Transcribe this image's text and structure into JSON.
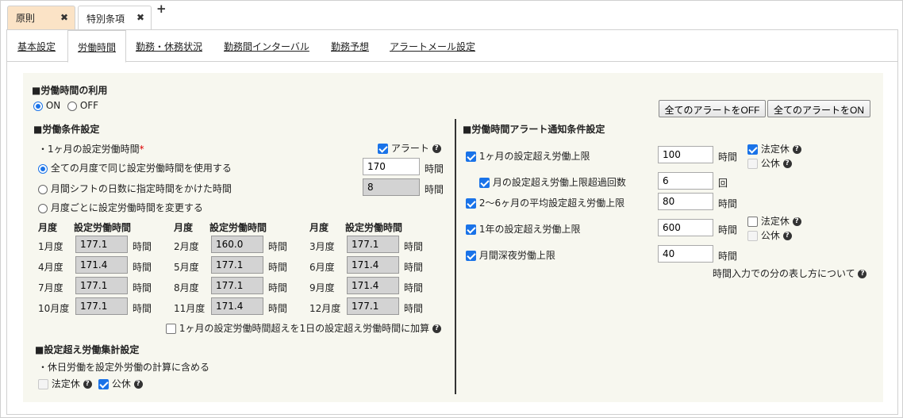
{
  "top_tabs": [
    {
      "label": "原則"
    },
    {
      "label": "特別条項"
    }
  ],
  "add_tab_symbol": "+",
  "close_symbol": "✖",
  "subtabs": [
    "基本設定",
    "労働時間",
    "勤務・休務状況",
    "勤務間インターバル",
    "勤務予想",
    "アラートメール設定"
  ],
  "usage": {
    "title": "■労働時間の利用",
    "on_label": "ON",
    "off_label": "OFF",
    "selected": "ON"
  },
  "buttons": {
    "all_off": "全てのアラートをOFF",
    "all_on": "全てのアラートをON"
  },
  "conditions": {
    "title": "■労働条件設定",
    "monthly_label": "・1ヶ月の設定労働時間",
    "required_mark": "*",
    "alert_label": "アラート",
    "opt_same": "全ての月度で同じ設定労働時間を使用する",
    "opt_same_value": "170",
    "opt_shift": "月間シフトの日数に指定時間をかけた時間",
    "opt_shift_value": "8",
    "opt_change": "月度ごとに設定労働時間を変更する",
    "unit": "時間",
    "col_month": "月度",
    "col_hours": "設定労働時間",
    "months": [
      {
        "label": "1月度",
        "value": "177.1"
      },
      {
        "label": "2月度",
        "value": "160.0"
      },
      {
        "label": "3月度",
        "value": "177.1"
      },
      {
        "label": "4月度",
        "value": "171.4"
      },
      {
        "label": "5月度",
        "value": "177.1"
      },
      {
        "label": "6月度",
        "value": "171.4"
      },
      {
        "label": "7月度",
        "value": "177.1"
      },
      {
        "label": "8月度",
        "value": "177.1"
      },
      {
        "label": "9月度",
        "value": "171.4"
      },
      {
        "label": "10月度",
        "value": "177.1"
      },
      {
        "label": "11月度",
        "value": "171.4"
      },
      {
        "label": "12月度",
        "value": "177.1"
      }
    ],
    "add_label": "1ヶ月の設定労働時間超えを1日の設定超え労働時間に加算"
  },
  "overtime": {
    "title": "■設定超え労働集計設定",
    "holiday_label": "・休日労働を設定外労働の計算に含める",
    "legal_label": "法定休",
    "public_label": "公休"
  },
  "alerts": {
    "title": "■労働時間アラート通知条件設定",
    "rows": [
      {
        "label": "1ヶ月の設定超え労働上限",
        "value": "100",
        "unit": "時間"
      },
      {
        "label": "月の設定超え労働上限超過回数",
        "value": "6",
        "unit": "回"
      },
      {
        "label": "2〜6ヶ月の平均設定超え労働上限",
        "value": "80",
        "unit": "時間"
      },
      {
        "label": "1年の設定超え労働上限",
        "value": "600",
        "unit": "時間"
      },
      {
        "label": "月間深夜労働上限",
        "value": "40",
        "unit": "時間"
      }
    ],
    "legal_label": "法定休",
    "public_label": "公休",
    "help_link": "時間入力での分の表し方について"
  }
}
